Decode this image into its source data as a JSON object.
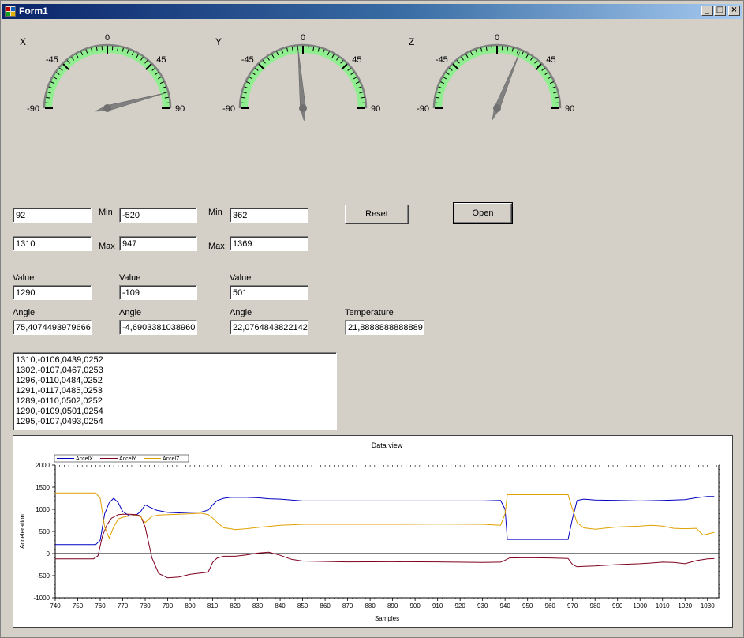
{
  "window": {
    "title": "Form1"
  },
  "title_buttons": {
    "minimize": "_",
    "maximize": "□",
    "close": "×"
  },
  "gauges": [
    {
      "label": "X",
      "ticks": [
        "-90",
        "-45",
        "0",
        "45",
        "90"
      ],
      "needle_angle": 75.4074493979666
    },
    {
      "label": "Y",
      "ticks": [
        "-90",
        "-45",
        "0",
        "45",
        "90"
      ],
      "needle_angle": -4.69033810389601
    },
    {
      "label": "Z",
      "ticks": [
        "-90",
        "-45",
        "0",
        "45",
        "90"
      ],
      "needle_angle": 22.0764843822142
    }
  ],
  "calib": {
    "x_min": "92",
    "x_max": "1310",
    "y_min": "-520",
    "y_max": "947",
    "z_min": "362",
    "z_max": "1369",
    "min_label": "Min",
    "max_label": "Max"
  },
  "buttons": {
    "reset": "Reset",
    "open": "Open"
  },
  "values": {
    "value_label": "Value",
    "angle_label": "Angle",
    "temperature_label": "Temperature",
    "x_value": "1290",
    "y_value": "-109",
    "z_value": "501",
    "x_angle": "75,4074493979666",
    "y_angle": "-4,69033810389601",
    "z_angle": "22,0764843822142",
    "temperature": "21,8888888888889"
  },
  "log_lines": [
    "1310,-0106,0439,0252",
    "1302,-0107,0467,0253",
    "1296,-0110,0484,0252",
    "1291,-0117,0485,0253",
    "1289,-0110,0502,0252",
    "1290,-0109,0501,0254",
    "1295,-0107,0493,0254"
  ],
  "chart_data": {
    "type": "line",
    "title": "Data view",
    "xlabel": "Samples",
    "ylabel": "Acceleration",
    "xlim": [
      740,
      1035
    ],
    "ylim": [
      -1000,
      2000
    ],
    "xticks": [
      740,
      750,
      760,
      770,
      780,
      790,
      800,
      810,
      820,
      830,
      840,
      850,
      860,
      870,
      880,
      890,
      900,
      910,
      920,
      930,
      940,
      950,
      960,
      970,
      980,
      990,
      1000,
      1010,
      1020,
      1030
    ],
    "yticks": [
      -1000,
      -500,
      0,
      500,
      1000,
      1500,
      2000
    ],
    "legend_position": "top-left",
    "series": [
      {
        "name": "AccelX",
        "color": "#0000c0",
        "x": [
          740,
          758,
          760,
          762,
          764,
          766,
          768,
          770,
          773,
          776,
          778,
          780,
          782,
          785,
          790,
          795,
          800,
          805,
          808,
          810,
          812,
          815,
          818,
          820,
          825,
          830,
          835,
          840,
          845,
          850,
          870,
          890,
          910,
          930,
          938,
          940,
          941,
          945,
          950,
          960,
          968,
          970,
          972,
          975,
          980,
          990,
          1000,
          1010,
          1020,
          1025,
          1030,
          1033
        ],
        "y": [
          200,
          200,
          300,
          900,
          1150,
          1250,
          1150,
          950,
          850,
          870,
          950,
          1100,
          1050,
          980,
          930,
          920,
          930,
          940,
          980,
          1100,
          1200,
          1250,
          1270,
          1270,
          1270,
          1260,
          1240,
          1230,
          1210,
          1190,
          1190,
          1190,
          1190,
          1190,
          1200,
          1000,
          320,
          320,
          320,
          320,
          320,
          800,
          1200,
          1230,
          1210,
          1200,
          1190,
          1200,
          1220,
          1260,
          1290,
          1290
        ]
      },
      {
        "name": "AccelY",
        "color": "#800020",
        "x": [
          740,
          757,
          759,
          761,
          763,
          765,
          768,
          770,
          773,
          776,
          778,
          780,
          783,
          786,
          790,
          795,
          800,
          805,
          808,
          810,
          812,
          815,
          820,
          825,
          830,
          835,
          840,
          845,
          850,
          870,
          890,
          910,
          930,
          938,
          940,
          942,
          950,
          960,
          968,
          970,
          972,
          975,
          980,
          990,
          1000,
          1005,
          1010,
          1015,
          1020,
          1025,
          1030,
          1033
        ],
        "y": [
          -120,
          -120,
          -50,
          400,
          650,
          800,
          880,
          890,
          890,
          880,
          850,
          600,
          -100,
          -450,
          -550,
          -530,
          -470,
          -440,
          -420,
          -200,
          -100,
          -60,
          -60,
          -30,
          10,
          30,
          -40,
          -130,
          -170,
          -190,
          -185,
          -190,
          -200,
          -195,
          -150,
          -100,
          -95,
          -100,
          -110,
          -250,
          -300,
          -290,
          -280,
          -250,
          -230,
          -215,
          -195,
          -200,
          -230,
          -160,
          -120,
          -115
        ]
      },
      {
        "name": "AccelZ",
        "color": "#e0a000",
        "x": [
          740,
          758,
          760,
          762,
          764,
          766,
          768,
          770,
          773,
          776,
          778,
          780,
          783,
          786,
          790,
          795,
          800,
          805,
          808,
          810,
          812,
          815,
          818,
          820,
          825,
          830,
          840,
          850,
          870,
          890,
          910,
          930,
          938,
          940,
          941,
          945,
          950,
          960,
          968,
          970,
          972,
          975,
          980,
          990,
          1000,
          1005,
          1010,
          1015,
          1020,
          1025,
          1028,
          1030,
          1033
        ],
        "y": [
          1370,
          1370,
          1250,
          600,
          350,
          600,
          780,
          820,
          850,
          860,
          830,
          700,
          840,
          870,
          880,
          890,
          900,
          910,
          880,
          800,
          700,
          580,
          560,
          540,
          560,
          590,
          640,
          660,
          660,
          660,
          665,
          660,
          640,
          900,
          1330,
          1330,
          1330,
          1330,
          1330,
          1000,
          700,
          580,
          550,
          600,
          620,
          640,
          620,
          570,
          560,
          570,
          420,
          440,
          480
        ]
      }
    ]
  }
}
